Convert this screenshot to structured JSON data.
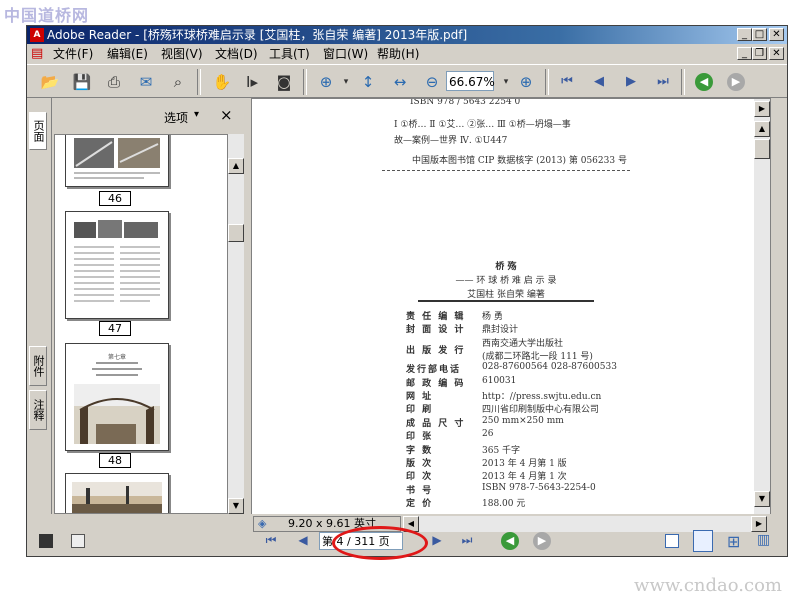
{
  "watermarks": {
    "top_left": "中国道桥网",
    "bottom_right": "www.cndao.com"
  },
  "window": {
    "title": "Adobe Reader - [桥殇环球桥难启示录 [艾国柱，张自荣 编著] 2013年版.pdf]"
  },
  "menu": [
    "文件(F)",
    "编辑(E)",
    "视图(V)",
    "文档(D)",
    "工具(T)",
    "窗口(W)",
    "帮助(H)"
  ],
  "toolbar": {
    "zoom_value": "66.67%"
  },
  "side_tabs": [
    "页面",
    "附件",
    "注释"
  ],
  "panel": {
    "options_label": "选项",
    "options_arrow": "▾",
    "close_label": "×"
  },
  "thumbnails": [
    {
      "page": "46"
    },
    {
      "page": "47"
    },
    {
      "page": "48",
      "heading": "第七章"
    },
    {
      "page": ""
    }
  ],
  "document": {
    "isbn_top": "ISBN 978 / 5643 2254 0",
    "cat_line1": "Ⅰ  ①桥… Ⅱ ①艾… ②张… Ⅲ ①桥—坍塌—事",
    "cat_line2": "故—案例—世界 Ⅳ. ①U447",
    "cip": "中国版本图书馆 CIP 数据核字 (2013) 第 056233 号",
    "book_title": "桥  殇",
    "book_subtitle": "—— 环 球 桥 难 启 示 录",
    "book_authors": "艾国柱   张自荣   编著",
    "rows": [
      {
        "label": "责 任 编 辑",
        "value": "杨   勇"
      },
      {
        "label": "封 面 设 计",
        "value": "鼎封设计"
      },
      {
        "label": "出 版 发 行",
        "value": "西南交通大学出版社",
        "value2": "(成都二环路北一段 111 号)"
      },
      {
        "label": "发行部电话",
        "value": "028-87600564   028-87600533"
      },
      {
        "label": "邮 政 编 码",
        "value": "610031"
      },
      {
        "label": "网       址",
        "value": "http：//press.swjtu.edu.cn"
      },
      {
        "label": "印       刷",
        "value": "四川省印刷制版中心有限公司"
      },
      {
        "label": "成 品 尺 寸",
        "value": "250 mm×250 mm"
      },
      {
        "label": "印       张",
        "value": "26"
      },
      {
        "label": "字       数",
        "value": "365 千字"
      },
      {
        "label": "版       次",
        "value": "2013 年 4 月第 1 版"
      },
      {
        "label": "印       次",
        "value": "2013 年 4 月第 1 次"
      },
      {
        "label": "书       号",
        "value": "ISBN 978-7-5643-2254-0"
      },
      {
        "label": "定       价",
        "value": "188.00 元"
      }
    ]
  },
  "status": {
    "page_size": "9.20 x 9.61 英寸",
    "page_indicator": "第 4 / 311 页"
  }
}
